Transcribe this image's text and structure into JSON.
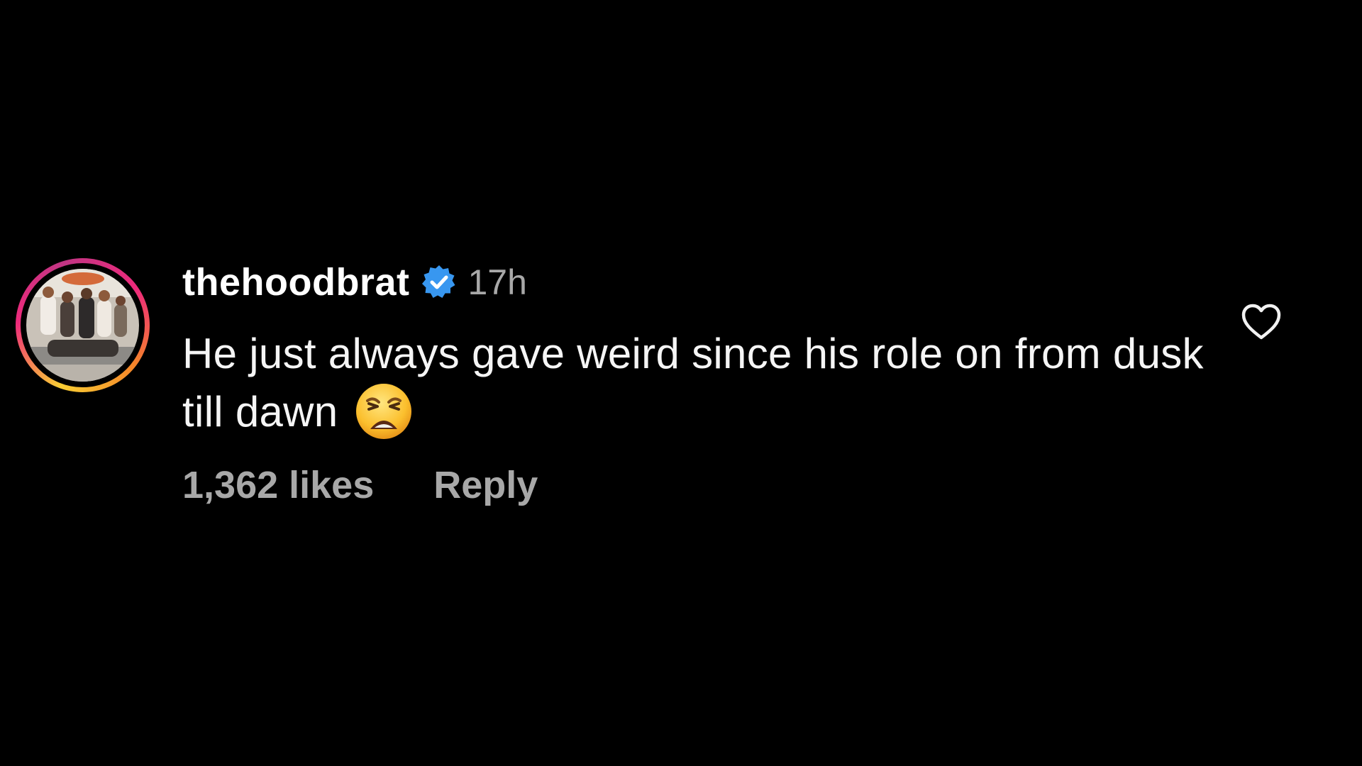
{
  "comment": {
    "username": "thehoodbrat",
    "verified": true,
    "time_ago": "17h",
    "text": "He just always gave weird since his role on from dusk till dawn",
    "emoji": "weary-face-emoji",
    "likes_label": "1,362 likes",
    "reply_label": "Reply"
  },
  "icons": {
    "verified_badge": "verified-badge-icon",
    "like": "heart-outline-icon"
  },
  "colors": {
    "background": "#000000",
    "text": "#ffffff",
    "secondary_text": "#a8a8a8",
    "verified_blue": "#3897f0"
  }
}
